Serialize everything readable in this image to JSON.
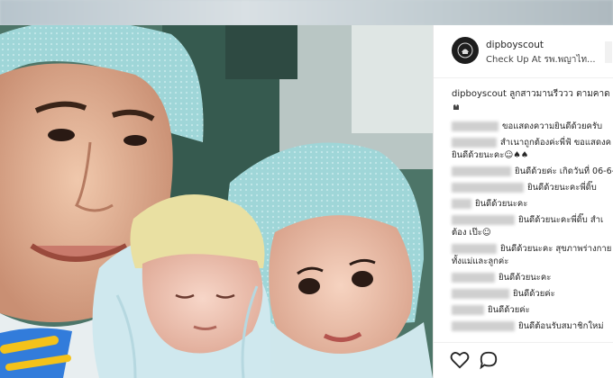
{
  "post": {
    "username": "dipboyscout",
    "location": "Check Up At รพ.พญาไท...",
    "caption_user": "dipboyscout",
    "caption_text": "ลูกสาวมานรีววว ตามคาด"
  },
  "comments": [
    {
      "text": "ขอแสดงความยินดีด้วยครับ"
    },
    {
      "text": "สำเนาถูกต้องค่ะพี่ฟ้ ขอแสดงค"
    },
    {
      "text": "ยินดีด้วยนะคะ☺♠♠"
    },
    {
      "text": "ยินดีด้วยค่ะ เกิดวันที่ 06-6-60"
    },
    {
      "text": "ยินดีด้วยนะคะพี่ดิ๊บ"
    },
    {
      "text": "ยินดีด้วยนะคะ"
    },
    {
      "text": "ยินดีด้วยนะคะพี่ดิ๊บ สำเ"
    },
    {
      "text": "ต้อง เป๊ะ☺"
    },
    {
      "text": "ยินดีด้วยนะคะ สุขภาพร่างกาย"
    },
    {
      "text": "ทั้งแม่และลูกค่ะ"
    },
    {
      "text": "ยินดีด้วยนะคะ"
    },
    {
      "text": "ยินดีด้วยค่ะ"
    },
    {
      "text": "ยินดีด้วยค่ะ"
    },
    {
      "text": "ยินดีต้อนรับสมาชิกใหม่"
    }
  ],
  "icons": {
    "like": "heart-icon",
    "comment": "comment-icon",
    "avatar": "scout-logo-icon"
  },
  "colors": {
    "cap": "#9bd3d6",
    "blanket": "#cde8ee",
    "background_green": "#4a6f64",
    "text": "#262626"
  }
}
